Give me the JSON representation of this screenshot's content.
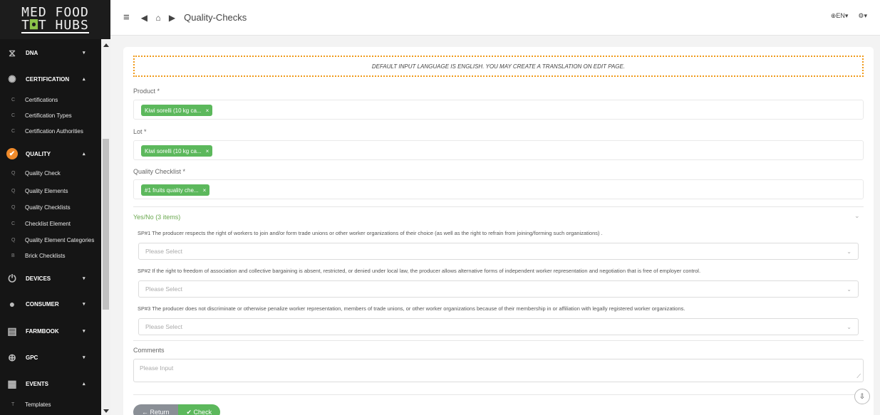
{
  "logo": {
    "line1": "MED FOOD",
    "line2_a": "T",
    "line2_hl": "◘",
    "line2_b": "T HUBS"
  },
  "sidebar": {
    "sections": [
      {
        "label": "DNA",
        "icon": "hourglass-icon",
        "glyph": "⧖",
        "caret": "▾"
      },
      {
        "label": "CERTIFICATION",
        "icon": "seal-icon",
        "glyph": "✺",
        "caret": "▴"
      },
      {
        "label": "QUALITY",
        "icon": "check-circle-icon",
        "glyph": "✔",
        "caret": "▴"
      },
      {
        "label": "DEVICES",
        "icon": "power-icon",
        "glyph": "⏻",
        "caret": "▾"
      },
      {
        "label": "CONSUMER",
        "icon": "user-icon",
        "glyph": "●",
        "caret": "▾"
      },
      {
        "label": "FARMBOOK",
        "icon": "book-icon",
        "glyph": "▤",
        "caret": "▾"
      },
      {
        "label": "GPC",
        "icon": "globe-icon",
        "glyph": "⊕",
        "caret": "▾"
      },
      {
        "label": "EVENTS",
        "icon": "calendar-icon",
        "glyph": "▦",
        "caret": "▴"
      }
    ],
    "cert_items": [
      {
        "letter": "C",
        "label": "Certifications"
      },
      {
        "letter": "C",
        "label": "Certification Types"
      },
      {
        "letter": "C",
        "label": "Certification Authorities"
      }
    ],
    "quality_items": [
      {
        "letter": "Q",
        "label": "Quality Check"
      },
      {
        "letter": "Q",
        "label": "Quality Elements"
      },
      {
        "letter": "Q",
        "label": "Quality Checklists"
      },
      {
        "letter": "C",
        "label": "Checklist Element"
      },
      {
        "letter": "Q",
        "label": "Quality Element Categories"
      },
      {
        "letter": "B",
        "label": "Brick Checklists"
      }
    ],
    "events_items": [
      {
        "letter": "T",
        "label": "Templates"
      }
    ]
  },
  "topbar": {
    "menu_glyph": "≡",
    "nav_glyphs": "◀ ⌂ ▶",
    "title": "Quality-Checks",
    "lang": "⊕EN▾",
    "settings": "⚙▾"
  },
  "form": {
    "notice": "DEFAULT INPUT LANGUAGE IS ENGLISH. YOU MAY CREATE A TRANSLATION ON EDIT PAGE.",
    "product_label": "Product *",
    "product_tag": "Kiwi sorelli (10 kg ca...",
    "lot_label": "Lot *",
    "lot_tag": "Kiwi sorelli (10 kg ca...",
    "checklist_label": "Quality Checklist *",
    "checklist_tag": "#1 fruits quality che...",
    "tag_close": "×",
    "yesno_header": "Yes/No (3 items)",
    "questions": [
      "SP#1 The producer respects the right of workers to join and/or form trade unions or other worker organizations of their choice (as well as the right to refrain from joining/forming such organizations) .",
      "SP#2 If the right to freedom of association and collective bargaining is absent, restricted, or denied under local law, the producer allows alternative forms of independent worker representation and negotiation that is free of employer control.",
      "SP#3 The producer does not discriminate or otherwise penalize worker representation, members of trade unions, or other worker organizations because of their membership in or affiliation with legally registered worker organizations."
    ],
    "select_placeholder": "Please Select",
    "comments_label": "Comments",
    "comments_placeholder": "Please Input",
    "return_label": "← Return",
    "check_label": "✔ Check"
  }
}
